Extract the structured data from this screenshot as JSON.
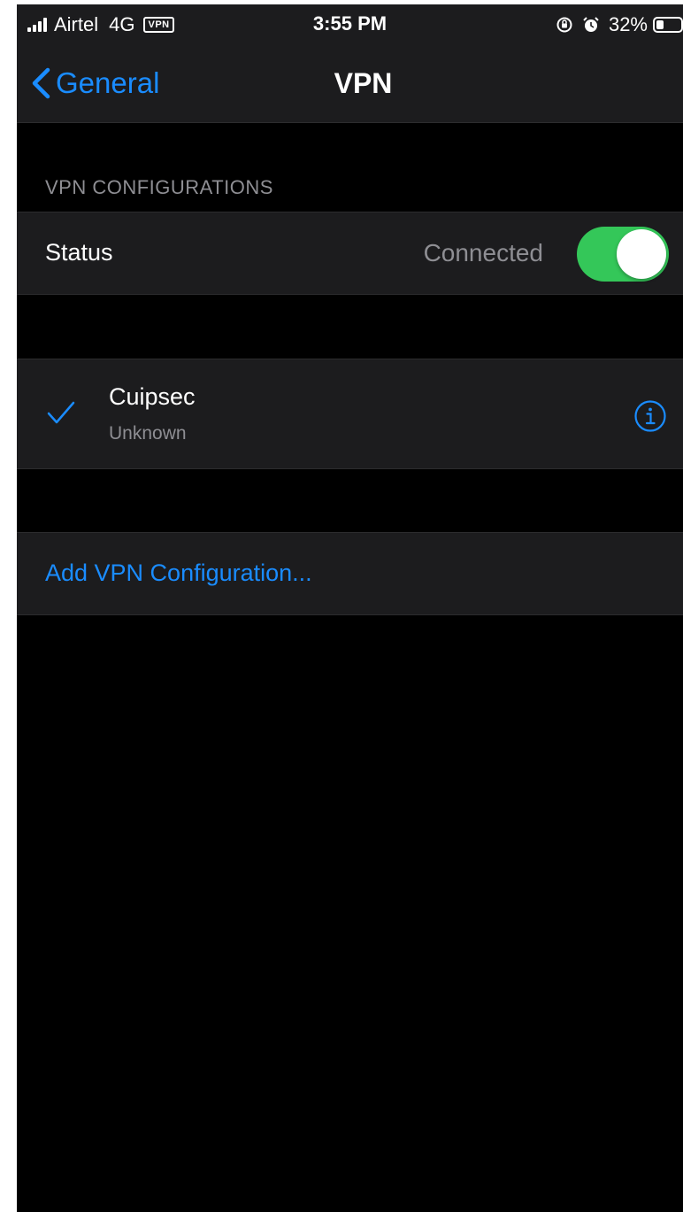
{
  "status_bar": {
    "carrier": "Airtel",
    "network": "4G",
    "vpn_badge": "VPN",
    "time": "3:55 PM",
    "battery_percent": "32%",
    "battery_level": 0.32,
    "icons": [
      "signal-icon",
      "vpn-badge",
      "orientation-lock-icon",
      "alarm-icon",
      "battery-icon"
    ]
  },
  "nav": {
    "back_label": "General",
    "title": "VPN"
  },
  "section": {
    "header": "VPN CONFIGURATIONS"
  },
  "status_row": {
    "label": "Status",
    "value": "Connected",
    "toggle_on": true,
    "toggle_color": "#34c759"
  },
  "vpn_item": {
    "name": "Cuipsec",
    "subtitle": "Unknown",
    "selected": true
  },
  "add_row": {
    "label": "Add VPN Configuration..."
  },
  "colors": {
    "accent": "#1a8cff",
    "background": "#000000",
    "cell": "#1c1c1e",
    "secondary_text": "#8e8e93"
  }
}
